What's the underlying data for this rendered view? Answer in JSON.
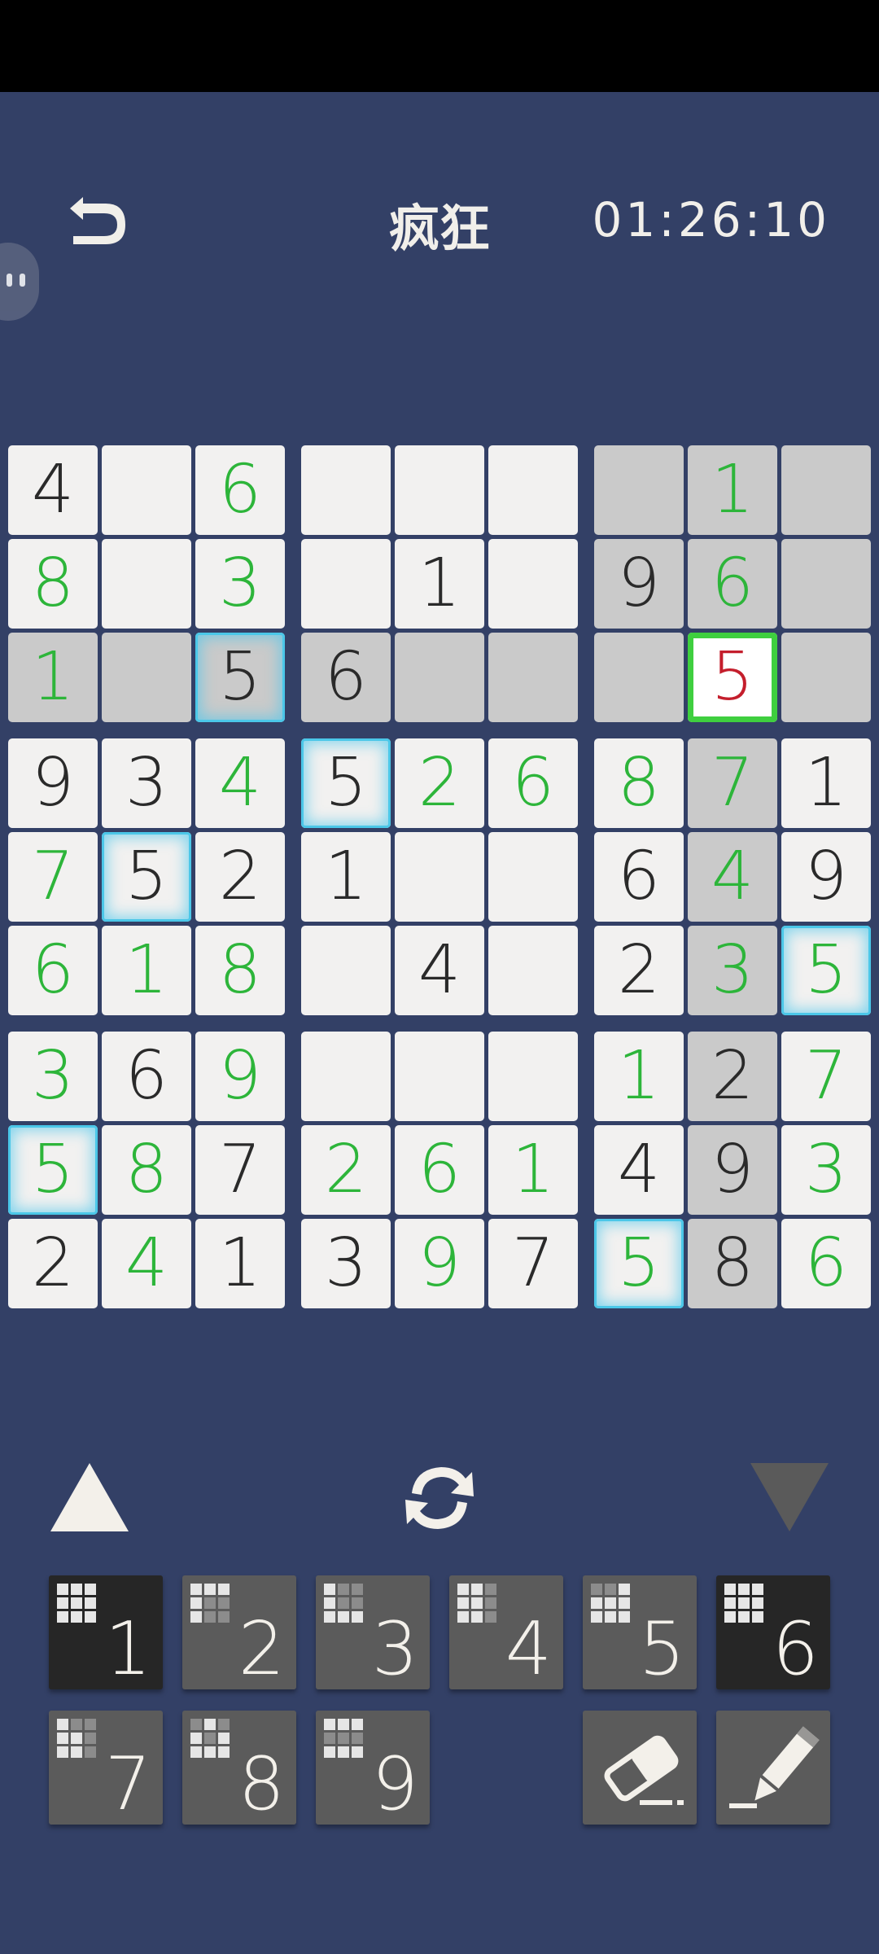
{
  "header": {
    "title": "疯狂",
    "timer": "01:26:10"
  },
  "board": {
    "rows": [
      [
        "4",
        "",
        "6",
        "",
        "",
        "",
        "",
        "1",
        ""
      ],
      [
        "8",
        "",
        "3",
        "",
        "1",
        "",
        "9",
        "6",
        ""
      ],
      [
        "1",
        "",
        "5",
        "6",
        "",
        "",
        "",
        "5",
        ""
      ],
      [
        "9",
        "3",
        "4",
        "5",
        "2",
        "6",
        "8",
        "7",
        "1"
      ],
      [
        "7",
        "5",
        "2",
        "1",
        "",
        "",
        "6",
        "4",
        "9"
      ],
      [
        "6",
        "1",
        "8",
        "",
        "4",
        "",
        "2",
        "3",
        "5"
      ],
      [
        "3",
        "6",
        "9",
        "",
        "",
        "",
        "1",
        "2",
        "7"
      ],
      [
        "5",
        "8",
        "7",
        "2",
        "6",
        "1",
        "4",
        "9",
        "3"
      ],
      [
        "2",
        "4",
        "1",
        "3",
        "9",
        "7",
        "5",
        "8",
        "6"
      ]
    ],
    "kinds": [
      [
        "g",
        "e",
        "u",
        "e",
        "e",
        "e",
        "e",
        "u",
        "e"
      ],
      [
        "u",
        "e",
        "u",
        "e",
        "g",
        "e",
        "g",
        "u",
        "e"
      ],
      [
        "u",
        "e",
        "g",
        "g",
        "e",
        "e",
        "e",
        "s",
        "e"
      ],
      [
        "g",
        "g",
        "u",
        "g",
        "u",
        "u",
        "u",
        "u",
        "g"
      ],
      [
        "u",
        "g",
        "g",
        "g",
        "e",
        "e",
        "g",
        "u",
        "g"
      ],
      [
        "u",
        "u",
        "u",
        "e",
        "g",
        "e",
        "g",
        "u",
        "u"
      ],
      [
        "u",
        "g",
        "u",
        "e",
        "e",
        "e",
        "u",
        "g",
        "u"
      ],
      [
        "u",
        "u",
        "g",
        "u",
        "u",
        "u",
        "g",
        "g",
        "u"
      ],
      [
        "g",
        "u",
        "g",
        "g",
        "u",
        "g",
        "u",
        "g",
        "u"
      ]
    ],
    "gray_cells": [
      [
        0,
        6
      ],
      [
        0,
        7
      ],
      [
        0,
        8
      ],
      [
        1,
        6
      ],
      [
        1,
        7
      ],
      [
        1,
        8
      ],
      [
        2,
        0
      ],
      [
        2,
        1
      ],
      [
        2,
        2
      ],
      [
        2,
        3
      ],
      [
        2,
        4
      ],
      [
        2,
        5
      ],
      [
        2,
        6
      ],
      [
        2,
        8
      ],
      [
        3,
        7
      ],
      [
        4,
        7
      ],
      [
        5,
        7
      ],
      [
        6,
        7
      ],
      [
        7,
        7
      ],
      [
        8,
        7
      ]
    ],
    "highlighted_cells": [
      [
        2,
        2
      ],
      [
        3,
        3
      ],
      [
        4,
        1
      ],
      [
        5,
        8
      ],
      [
        7,
        0
      ],
      [
        8,
        6
      ]
    ],
    "selected_cell": [
      2,
      7
    ],
    "selected_is_error": true,
    "colors": {
      "user_digit": "#2db53a",
      "given_digit": "#2a2a2a",
      "error_digit": "#c41e2c",
      "selection_border": "#3fcf3f",
      "highlight_glow": "#4bc7e8"
    }
  },
  "numpad": {
    "keys": [
      {
        "label": "1",
        "state": "done"
      },
      {
        "label": "2",
        "state": "active"
      },
      {
        "label": "3",
        "state": "active"
      },
      {
        "label": "4",
        "state": "active"
      },
      {
        "label": "5",
        "state": "active"
      },
      {
        "label": "6",
        "state": "done"
      },
      {
        "label": "7",
        "state": "active"
      },
      {
        "label": "8",
        "state": "active"
      },
      {
        "label": "9",
        "state": "active"
      }
    ]
  },
  "icons": {
    "back": "undo-arrow-icon",
    "refresh": "refresh-icon",
    "up": "triangle-up-icon",
    "down": "triangle-down-icon",
    "eraser": "eraser-icon",
    "pencil": "pencil-icon"
  }
}
